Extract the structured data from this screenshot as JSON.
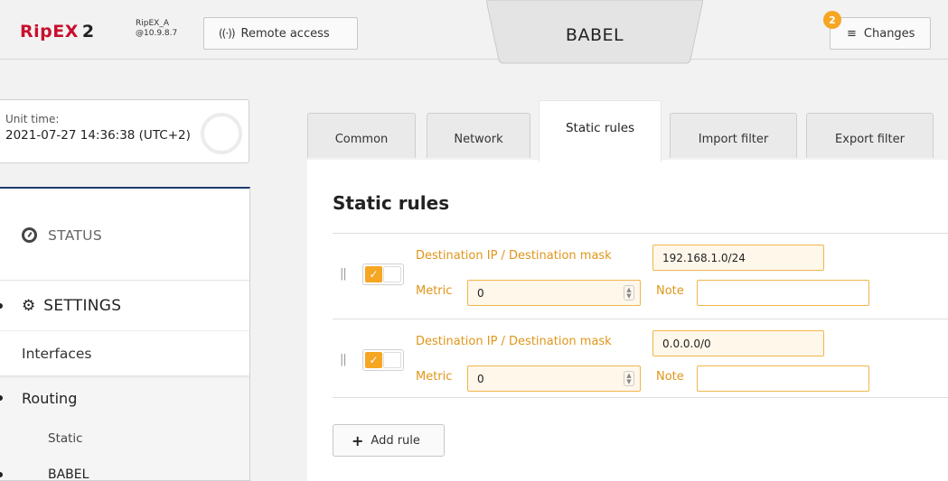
{
  "header": {
    "logo_main": "RipEX",
    "logo_suffix": "2",
    "unit_name": "RipEX_A",
    "unit_ip": "@10.9.8.7",
    "remote_access_label": "Remote access",
    "page_title": "BABEL",
    "changes_label": "Changes",
    "changes_count": "2",
    "accent_color": "#f5a623",
    "brand_color": "#c8102e"
  },
  "sidebar": {
    "unit_time_label": "Unit time:",
    "unit_time_value": "2021-07-27 14:36:38 (UTC+2)",
    "status_label": "STATUS",
    "settings_label": "SETTINGS",
    "interfaces_label": "Interfaces",
    "routing_label": "Routing",
    "static_label": "Static",
    "babel_label": "BABEL"
  },
  "tabs": [
    {
      "label": "Common",
      "active": false
    },
    {
      "label": "Network",
      "active": false
    },
    {
      "label": "Static rules",
      "active": true
    },
    {
      "label": "Import filter",
      "active": false
    },
    {
      "label": "Export filter",
      "active": false
    }
  ],
  "main": {
    "heading": "Static rules",
    "dest_label": "Destination IP / Destination mask",
    "metric_label": "Metric",
    "note_label": "Note",
    "rules": [
      {
        "enabled": true,
        "destination": "192.168.1.0/24",
        "metric": "0",
        "note": ""
      },
      {
        "enabled": true,
        "destination": "0.0.0.0/0",
        "metric": "0",
        "note": ""
      }
    ],
    "add_rule_label": "Add rule"
  }
}
